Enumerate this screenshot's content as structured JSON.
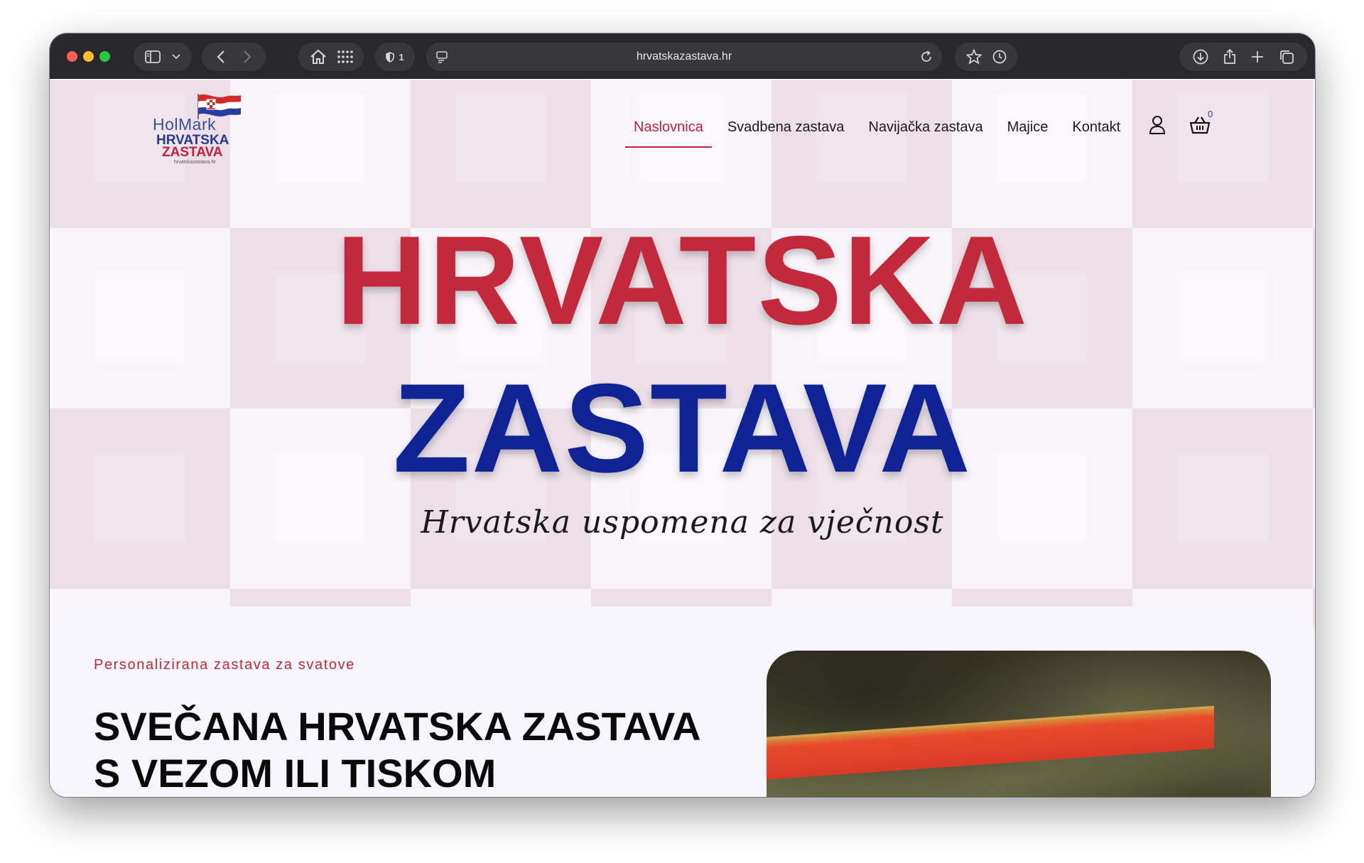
{
  "browser": {
    "url": "hrvatskazastava.hr",
    "shield_count": "1"
  },
  "logo": {
    "holmark": "HolMark",
    "line1": "HRVATSKA",
    "line2": "ZASTAVA",
    "url": "hrvatskazastava.hr"
  },
  "nav": {
    "items": [
      {
        "label": "Naslovnica",
        "active": true
      },
      {
        "label": "Svadbena zastava"
      },
      {
        "label": "Navijačka zastava"
      },
      {
        "label": "Majice"
      },
      {
        "label": "Kontakt"
      }
    ],
    "cart_count": "0"
  },
  "hero": {
    "line1": "HRVATSKA",
    "line2": "ZASTAVA",
    "tagline": "Hrvatska uspomena za vječnost"
  },
  "section": {
    "kicker": "Personalizirana zastava za svatove",
    "title": "SVEČANA HRVATSKA ZASTAVA S VEZOM ILI TISKOM"
  },
  "colors": {
    "accent_red": "#c22a3c",
    "accent_blue": "#0f2394",
    "chrome": "#29292c"
  }
}
